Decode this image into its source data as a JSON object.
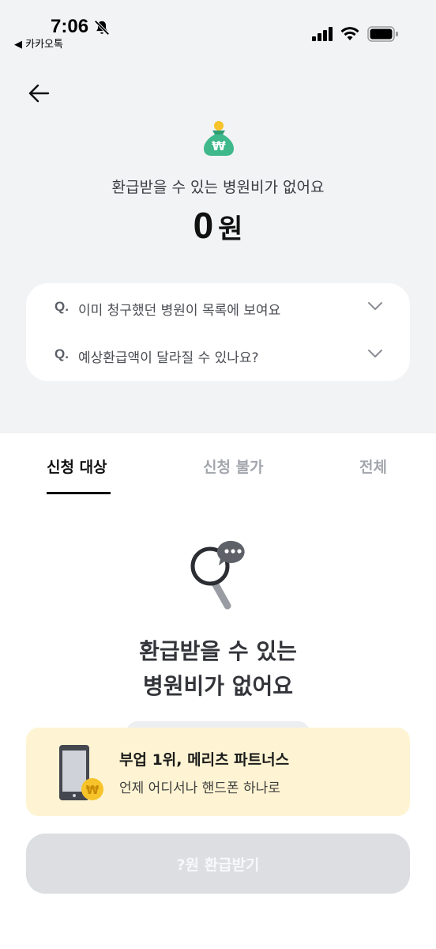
{
  "status_bar": {
    "time": "7:06",
    "back_app": "◀ 카카오톡"
  },
  "header": {
    "headline": "환급받을 수 있는 병원비가 없어요",
    "amount": "0",
    "amount_unit": "원"
  },
  "faq": {
    "q_prefix": "Q.",
    "items": [
      {
        "text": "이미 청구했던 병원이 목록에 보여요"
      },
      {
        "text": "예상환급액이 달라질 수 있나요?"
      }
    ]
  },
  "tabs": [
    {
      "label": "신청 대상",
      "active": true
    },
    {
      "label": "신청 불가",
      "active": false
    },
    {
      "label": "전체",
      "active": false
    }
  ],
  "empty_state": {
    "line1": "환급받을 수 있는",
    "line2": "병원비가 없어요"
  },
  "promo": {
    "title": "부업 1위, 메리츠 파트너스",
    "subtitle": "언제 어디서나 핸드폰 하나로"
  },
  "cta": {
    "label": "?원 환급받기"
  },
  "colors": {
    "top_bg": "#f2f3f5",
    "money_bag": "#3fb88c",
    "promo_bg": "#fef4d3",
    "coin": "#f6c32a",
    "cta_bg": "#dcdee2"
  },
  "icons": [
    "bell-slash-icon",
    "signal-icon",
    "wifi-icon",
    "battery-icon",
    "back-arrow-icon",
    "money-bag-icon",
    "chevron-down-icon",
    "search-chat-icon",
    "phone-coin-icon"
  ]
}
